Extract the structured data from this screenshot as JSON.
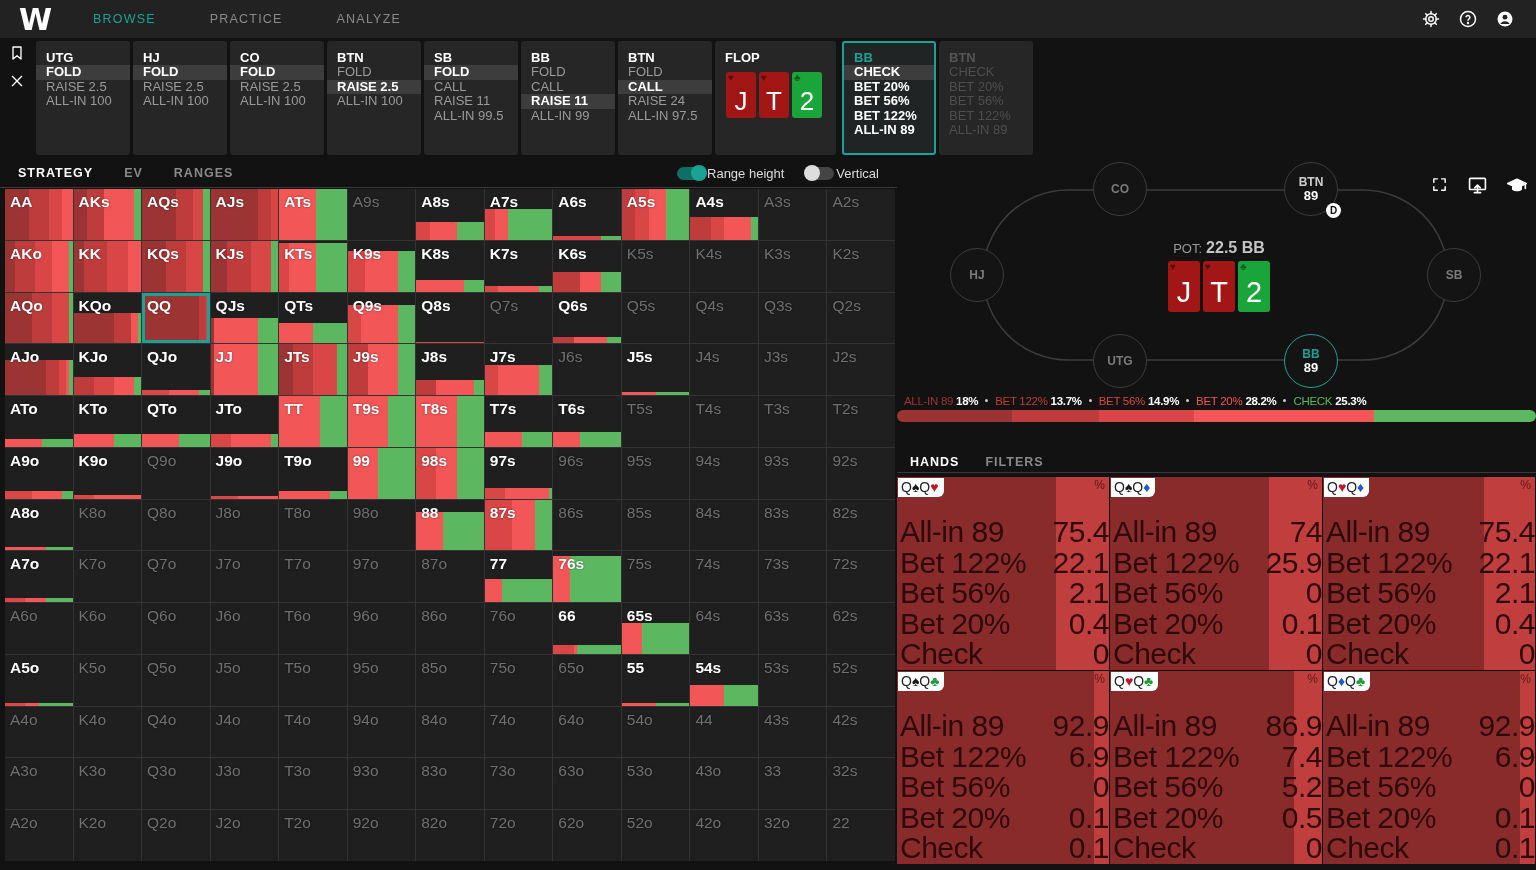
{
  "topbar": {
    "logo": "W",
    "nav": [
      {
        "label": "BROWSE",
        "selected": true
      },
      {
        "label": "PRACTICE",
        "selected": false
      },
      {
        "label": "ANALYZE",
        "selected": false
      }
    ]
  },
  "action_strip": {
    "columns": [
      {
        "kind": "action",
        "current": false,
        "disabled": false,
        "position": "UTG",
        "options": [
          {
            "label": "FOLD",
            "selected": true
          },
          {
            "label": "RAISE 2.5",
            "selected": false
          },
          {
            "label": "ALL-IN 100",
            "selected": false
          }
        ]
      },
      {
        "kind": "action",
        "current": false,
        "disabled": false,
        "position": "HJ",
        "options": [
          {
            "label": "FOLD",
            "selected": true
          },
          {
            "label": "RAISE 2.5",
            "selected": false
          },
          {
            "label": "ALL-IN 100",
            "selected": false
          }
        ]
      },
      {
        "kind": "action",
        "current": false,
        "disabled": false,
        "position": "CO",
        "options": [
          {
            "label": "FOLD",
            "selected": true
          },
          {
            "label": "RAISE 2.5",
            "selected": false
          },
          {
            "label": "ALL-IN 100",
            "selected": false
          }
        ]
      },
      {
        "kind": "action",
        "current": false,
        "disabled": false,
        "position": "BTN",
        "options": [
          {
            "label": "FOLD",
            "selected": false
          },
          {
            "label": "RAISE 2.5",
            "selected": true
          },
          {
            "label": "ALL-IN 100",
            "selected": false
          }
        ]
      },
      {
        "kind": "action",
        "current": false,
        "disabled": false,
        "position": "SB",
        "options": [
          {
            "label": "FOLD",
            "selected": true
          },
          {
            "label": "CALL",
            "selected": false
          },
          {
            "label": "RAISE 11",
            "selected": false
          },
          {
            "label": "ALL-IN 99.5",
            "selected": false
          }
        ]
      },
      {
        "kind": "action",
        "current": false,
        "disabled": false,
        "position": "BB",
        "options": [
          {
            "label": "FOLD",
            "selected": false
          },
          {
            "label": "CALL",
            "selected": false
          },
          {
            "label": "RAISE 11",
            "selected": true
          },
          {
            "label": "ALL-IN 99",
            "selected": false
          }
        ]
      },
      {
        "kind": "action",
        "current": false,
        "disabled": false,
        "position": "BTN",
        "options": [
          {
            "label": "FOLD",
            "selected": false
          },
          {
            "label": "CALL",
            "selected": true
          },
          {
            "label": "RAISE 24",
            "selected": false
          },
          {
            "label": "ALL-IN 97.5",
            "selected": false
          }
        ]
      },
      {
        "kind": "board",
        "title": "FLOP",
        "cards": [
          {
            "rank": "J",
            "suit": "♥",
            "kind": "heart"
          },
          {
            "rank": "T",
            "suit": "♥",
            "kind": "heart"
          },
          {
            "rank": "2",
            "suit": "♣",
            "kind": "club"
          }
        ]
      },
      {
        "kind": "action",
        "current": true,
        "disabled": false,
        "position": "BB",
        "options": [
          {
            "label": "CHECK",
            "selected": true
          },
          {
            "label": "BET 20%",
            "selected": false
          },
          {
            "label": "BET 56%",
            "selected": false
          },
          {
            "label": "BET 122%",
            "selected": false
          },
          {
            "label": "ALL-IN 89",
            "selected": false
          }
        ]
      },
      {
        "kind": "action",
        "current": false,
        "disabled": true,
        "position": "BTN",
        "options": [
          {
            "label": "CHECK",
            "selected": false
          },
          {
            "label": "BET 20%",
            "selected": false
          },
          {
            "label": "BET 56%",
            "selected": false
          },
          {
            "label": "BET 122%",
            "selected": false
          },
          {
            "label": "ALL-IN 89",
            "selected": false
          }
        ]
      }
    ]
  },
  "strategy": {
    "tabs": [
      {
        "label": "STRATEGY",
        "selected": true
      },
      {
        "label": "EV",
        "selected": false
      },
      {
        "label": "RANGES",
        "selected": false
      }
    ],
    "toggles": [
      {
        "label": "Range height",
        "on": true
      },
      {
        "label": "Vertical",
        "on": false
      }
    ],
    "grid": [
      {
        "cells": [
          {
            "label": "AA",
            "active": true,
            "selected": false
          },
          {
            "label": "AKs",
            "active": true,
            "selected": false
          },
          {
            "label": "AQs",
            "active": true,
            "selected": false
          },
          {
            "label": "AJs",
            "active": true,
            "selected": false
          },
          {
            "label": "ATs",
            "active": true,
            "selected": false
          },
          {
            "label": "A9s",
            "active": false,
            "selected": false
          },
          {
            "label": "A8s",
            "active": true,
            "selected": false
          },
          {
            "label": "A7s",
            "active": true,
            "selected": false
          },
          {
            "label": "A6s",
            "active": true,
            "selected": false
          },
          {
            "label": "A5s",
            "active": true,
            "selected": false
          },
          {
            "label": "A4s",
            "active": true,
            "selected": false
          },
          {
            "label": "A3s",
            "active": false,
            "selected": false
          },
          {
            "label": "A2s",
            "active": false,
            "selected": false
          }
        ]
      },
      {
        "cells": [
          {
            "label": "AKo",
            "active": true,
            "selected": false
          },
          {
            "label": "KK",
            "active": true,
            "selected": false
          },
          {
            "label": "KQs",
            "active": true,
            "selected": false
          },
          {
            "label": "KJs",
            "active": true,
            "selected": false
          },
          {
            "label": "KTs",
            "active": true,
            "selected": false
          },
          {
            "label": "K9s",
            "active": true,
            "selected": false
          },
          {
            "label": "K8s",
            "active": true,
            "selected": false
          },
          {
            "label": "K7s",
            "active": true,
            "selected": false
          },
          {
            "label": "K6s",
            "active": true,
            "selected": false
          },
          {
            "label": "K5s",
            "active": false,
            "selected": false
          },
          {
            "label": "K4s",
            "active": false,
            "selected": false
          },
          {
            "label": "K3s",
            "active": false,
            "selected": false
          },
          {
            "label": "K2s",
            "active": false,
            "selected": false
          }
        ]
      },
      {
        "cells": [
          {
            "label": "AQo",
            "active": true,
            "selected": false
          },
          {
            "label": "KQo",
            "active": true,
            "selected": false
          },
          {
            "label": "QQ",
            "active": true,
            "selected": true
          },
          {
            "label": "QJs",
            "active": true,
            "selected": false
          },
          {
            "label": "QTs",
            "active": true,
            "selected": false
          },
          {
            "label": "Q9s",
            "active": true,
            "selected": false
          },
          {
            "label": "Q8s",
            "active": true,
            "selected": false
          },
          {
            "label": "Q7s",
            "active": false,
            "selected": false
          },
          {
            "label": "Q6s",
            "active": true,
            "selected": false
          },
          {
            "label": "Q5s",
            "active": false,
            "selected": false
          },
          {
            "label": "Q4s",
            "active": false,
            "selected": false
          },
          {
            "label": "Q3s",
            "active": false,
            "selected": false
          },
          {
            "label": "Q2s",
            "active": false,
            "selected": false
          }
        ]
      },
      {
        "cells": [
          {
            "label": "AJo",
            "active": true,
            "selected": false
          },
          {
            "label": "KJo",
            "active": true,
            "selected": false
          },
          {
            "label": "QJo",
            "active": true,
            "selected": false
          },
          {
            "label": "JJ",
            "active": true,
            "selected": false
          },
          {
            "label": "JTs",
            "active": true,
            "selected": false
          },
          {
            "label": "J9s",
            "active": true,
            "selected": false
          },
          {
            "label": "J8s",
            "active": true,
            "selected": false
          },
          {
            "label": "J7s",
            "active": true,
            "selected": false
          },
          {
            "label": "J6s",
            "active": false,
            "selected": false
          },
          {
            "label": "J5s",
            "active": true,
            "selected": false
          },
          {
            "label": "J4s",
            "active": false,
            "selected": false
          },
          {
            "label": "J3s",
            "active": false,
            "selected": false
          },
          {
            "label": "J2s",
            "active": false,
            "selected": false
          }
        ]
      },
      {
        "cells": [
          {
            "label": "ATo",
            "active": true,
            "selected": false
          },
          {
            "label": "KTo",
            "active": true,
            "selected": false
          },
          {
            "label": "QTo",
            "active": true,
            "selected": false
          },
          {
            "label": "JTo",
            "active": true,
            "selected": false
          },
          {
            "label": "TT",
            "active": true,
            "selected": false
          },
          {
            "label": "T9s",
            "active": true,
            "selected": false
          },
          {
            "label": "T8s",
            "active": true,
            "selected": false
          },
          {
            "label": "T7s",
            "active": true,
            "selected": false
          },
          {
            "label": "T6s",
            "active": true,
            "selected": false
          },
          {
            "label": "T5s",
            "active": false,
            "selected": false
          },
          {
            "label": "T4s",
            "active": false,
            "selected": false
          },
          {
            "label": "T3s",
            "active": false,
            "selected": false
          },
          {
            "label": "T2s",
            "active": false,
            "selected": false
          }
        ]
      },
      {
        "cells": [
          {
            "label": "A9o",
            "active": true,
            "selected": false
          },
          {
            "label": "K9o",
            "active": true,
            "selected": false
          },
          {
            "label": "Q9o",
            "active": false,
            "selected": false
          },
          {
            "label": "J9o",
            "active": true,
            "selected": false
          },
          {
            "label": "T9o",
            "active": true,
            "selected": false
          },
          {
            "label": "99",
            "active": true,
            "selected": false
          },
          {
            "label": "98s",
            "active": true,
            "selected": false
          },
          {
            "label": "97s",
            "active": true,
            "selected": false
          },
          {
            "label": "96s",
            "active": false,
            "selected": false
          },
          {
            "label": "95s",
            "active": false,
            "selected": false
          },
          {
            "label": "94s",
            "active": false,
            "selected": false
          },
          {
            "label": "93s",
            "active": false,
            "selected": false
          },
          {
            "label": "92s",
            "active": false,
            "selected": false
          }
        ]
      },
      {
        "cells": [
          {
            "label": "A8o",
            "active": true,
            "selected": false
          },
          {
            "label": "K8o",
            "active": false,
            "selected": false
          },
          {
            "label": "Q8o",
            "active": false,
            "selected": false
          },
          {
            "label": "J8o",
            "active": false,
            "selected": false
          },
          {
            "label": "T8o",
            "active": false,
            "selected": false
          },
          {
            "label": "98o",
            "active": false,
            "selected": false
          },
          {
            "label": "88",
            "active": true,
            "selected": false
          },
          {
            "label": "87s",
            "active": true,
            "selected": false
          },
          {
            "label": "86s",
            "active": false,
            "selected": false
          },
          {
            "label": "85s",
            "active": false,
            "selected": false
          },
          {
            "label": "84s",
            "active": false,
            "selected": false
          },
          {
            "label": "83s",
            "active": false,
            "selected": false
          },
          {
            "label": "82s",
            "active": false,
            "selected": false
          }
        ]
      },
      {
        "cells": [
          {
            "label": "A7o",
            "active": true,
            "selected": false
          },
          {
            "label": "K7o",
            "active": false,
            "selected": false
          },
          {
            "label": "Q7o",
            "active": false,
            "selected": false
          },
          {
            "label": "J7o",
            "active": false,
            "selected": false
          },
          {
            "label": "T7o",
            "active": false,
            "selected": false
          },
          {
            "label": "97o",
            "active": false,
            "selected": false
          },
          {
            "label": "87o",
            "active": false,
            "selected": false
          },
          {
            "label": "77",
            "active": true,
            "selected": false
          },
          {
            "label": "76s",
            "active": true,
            "selected": false
          },
          {
            "label": "75s",
            "active": false,
            "selected": false
          },
          {
            "label": "74s",
            "active": false,
            "selected": false
          },
          {
            "label": "73s",
            "active": false,
            "selected": false
          },
          {
            "label": "72s",
            "active": false,
            "selected": false
          }
        ]
      },
      {
        "cells": [
          {
            "label": "A6o",
            "active": false,
            "selected": false
          },
          {
            "label": "K6o",
            "active": false,
            "selected": false
          },
          {
            "label": "Q6o",
            "active": false,
            "selected": false
          },
          {
            "label": "J6o",
            "active": false,
            "selected": false
          },
          {
            "label": "T6o",
            "active": false,
            "selected": false
          },
          {
            "label": "96o",
            "active": false,
            "selected": false
          },
          {
            "label": "86o",
            "active": false,
            "selected": false
          },
          {
            "label": "76o",
            "active": false,
            "selected": false
          },
          {
            "label": "66",
            "active": true,
            "selected": false
          },
          {
            "label": "65s",
            "active": true,
            "selected": false
          },
          {
            "label": "64s",
            "active": false,
            "selected": false
          },
          {
            "label": "63s",
            "active": false,
            "selected": false
          },
          {
            "label": "62s",
            "active": false,
            "selected": false
          }
        ]
      },
      {
        "cells": [
          {
            "label": "A5o",
            "active": true,
            "selected": false
          },
          {
            "label": "K5o",
            "active": false,
            "selected": false
          },
          {
            "label": "Q5o",
            "active": false,
            "selected": false
          },
          {
            "label": "J5o",
            "active": false,
            "selected": false
          },
          {
            "label": "T5o",
            "active": false,
            "selected": false
          },
          {
            "label": "95o",
            "active": false,
            "selected": false
          },
          {
            "label": "85o",
            "active": false,
            "selected": false
          },
          {
            "label": "75o",
            "active": false,
            "selected": false
          },
          {
            "label": "65o",
            "active": false,
            "selected": false
          },
          {
            "label": "55",
            "active": true,
            "selected": false
          },
          {
            "label": "54s",
            "active": true,
            "selected": false
          },
          {
            "label": "53s",
            "active": false,
            "selected": false
          },
          {
            "label": "52s",
            "active": false,
            "selected": false
          }
        ]
      },
      {
        "cells": [
          {
            "label": "A4o",
            "active": false,
            "selected": false
          },
          {
            "label": "K4o",
            "active": false,
            "selected": false
          },
          {
            "label": "Q4o",
            "active": false,
            "selected": false
          },
          {
            "label": "J4o",
            "active": false,
            "selected": false
          },
          {
            "label": "T4o",
            "active": false,
            "selected": false
          },
          {
            "label": "94o",
            "active": false,
            "selected": false
          },
          {
            "label": "84o",
            "active": false,
            "selected": false
          },
          {
            "label": "74o",
            "active": false,
            "selected": false
          },
          {
            "label": "64o",
            "active": false,
            "selected": false
          },
          {
            "label": "54o",
            "active": false,
            "selected": false
          },
          {
            "label": "44",
            "active": false,
            "selected": false
          },
          {
            "label": "43s",
            "active": false,
            "selected": false
          },
          {
            "label": "42s",
            "active": false,
            "selected": false
          }
        ]
      },
      {
        "cells": [
          {
            "label": "A3o",
            "active": false,
            "selected": false
          },
          {
            "label": "K3o",
            "active": false,
            "selected": false
          },
          {
            "label": "Q3o",
            "active": false,
            "selected": false
          },
          {
            "label": "J3o",
            "active": false,
            "selected": false
          },
          {
            "label": "T3o",
            "active": false,
            "selected": false
          },
          {
            "label": "93o",
            "active": false,
            "selected": false
          },
          {
            "label": "83o",
            "active": false,
            "selected": false
          },
          {
            "label": "73o",
            "active": false,
            "selected": false
          },
          {
            "label": "63o",
            "active": false,
            "selected": false
          },
          {
            "label": "53o",
            "active": false,
            "selected": false
          },
          {
            "label": "43o",
            "active": false,
            "selected": false
          },
          {
            "label": "33",
            "active": false,
            "selected": false
          },
          {
            "label": "32s",
            "active": false,
            "selected": false
          }
        ]
      },
      {
        "cells": [
          {
            "label": "A2o",
            "active": false,
            "selected": false
          },
          {
            "label": "K2o",
            "active": false,
            "selected": false
          },
          {
            "label": "Q2o",
            "active": false,
            "selected": false
          },
          {
            "label": "J2o",
            "active": false,
            "selected": false
          },
          {
            "label": "T2o",
            "active": false,
            "selected": false
          },
          {
            "label": "92o",
            "active": false,
            "selected": false
          },
          {
            "label": "82o",
            "active": false,
            "selected": false
          },
          {
            "label": "72o",
            "active": false,
            "selected": false
          },
          {
            "label": "62o",
            "active": false,
            "selected": false
          },
          {
            "label": "52o",
            "active": false,
            "selected": false
          },
          {
            "label": "42o",
            "active": false,
            "selected": false
          },
          {
            "label": "32o",
            "active": false,
            "selected": false
          },
          {
            "label": "22",
            "active": false,
            "selected": false
          }
        ]
      }
    ]
  },
  "table": {
    "seats": [
      {
        "position": "CO",
        "active": false
      },
      {
        "position": "BTN",
        "stack": "89",
        "dealer": "D",
        "active": false
      },
      {
        "position": "HJ",
        "active": false
      },
      {
        "position": "SB",
        "active": false
      },
      {
        "position": "UTG",
        "active": false
      },
      {
        "position": "BB",
        "stack": "89",
        "active": true
      }
    ],
    "pot": {
      "label": "POT:",
      "value": "22.5 BB"
    },
    "board": [
      {
        "rank": "J",
        "suit": "♥",
        "kind": "heart"
      },
      {
        "rank": "T",
        "suit": "♥",
        "kind": "heart"
      },
      {
        "rank": "2",
        "suit": "♣",
        "kind": "club"
      }
    ]
  },
  "strategy_summary": {
    "actions": [
      {
        "kind": "allin",
        "label": "ALL-IN 89",
        "value": "18%",
        "color": "#9c3434"
      },
      {
        "kind": "bet122",
        "label": "BET 122%",
        "value": "13.7%",
        "color": "#bf3c3c"
      },
      {
        "kind": "bet56",
        "label": "BET 56%",
        "value": "14.9%",
        "color": "#d84646"
      },
      {
        "kind": "bet20",
        "label": "BET 20%",
        "value": "28.2%",
        "color": "#f25656"
      },
      {
        "kind": "check",
        "label": "CHECK",
        "value": "25.3%",
        "color": "#5cb860"
      }
    ]
  },
  "hands": {
    "tabs": [
      {
        "label": "HANDS",
        "selected": true
      },
      {
        "label": "FILTERS",
        "selected": false
      }
    ],
    "combos": [
      {
        "cards": [
          {
            "rank": "Q",
            "suit": "♠",
            "kind": "spade"
          },
          {
            "rank": "Q",
            "suit": "♥",
            "kind": "heart"
          }
        ],
        "unit": "%",
        "level": 0.25,
        "rows": [
          {
            "label": "All-in 89",
            "value": "75.4"
          },
          {
            "label": "Bet 122%",
            "value": "22.1"
          },
          {
            "label": "Bet 56%",
            "value": "2.1"
          },
          {
            "label": "Bet 20%",
            "value": "0.4"
          },
          {
            "label": "Check",
            "value": "0"
          }
        ]
      },
      {
        "cards": [
          {
            "rank": "Q",
            "suit": "♠",
            "kind": "spade"
          },
          {
            "rank": "Q",
            "suit": "♦",
            "kind": "diamond"
          }
        ],
        "unit": "%",
        "level": 0.25,
        "rows": [
          {
            "label": "All-in 89",
            "value": "74"
          },
          {
            "label": "Bet 122%",
            "value": "25.9"
          },
          {
            "label": "Bet 56%",
            "value": "0"
          },
          {
            "label": "Bet 20%",
            "value": "0.1"
          },
          {
            "label": "Check",
            "value": "0"
          }
        ]
      },
      {
        "cards": [
          {
            "rank": "Q",
            "suit": "♥",
            "kind": "heart"
          },
          {
            "rank": "Q",
            "suit": "♦",
            "kind": "diamond"
          }
        ],
        "unit": "%",
        "level": 0.24,
        "rows": [
          {
            "label": "All-in 89",
            "value": "75.4"
          },
          {
            "label": "Bet 122%",
            "value": "22.1"
          },
          {
            "label": "Bet 56%",
            "value": "2.1"
          },
          {
            "label": "Bet 20%",
            "value": "0.4"
          },
          {
            "label": "Check",
            "value": "0"
          }
        ]
      },
      {
        "cards": [
          {
            "rank": "Q",
            "suit": "♠",
            "kind": "spade"
          },
          {
            "rank": "Q",
            "suit": "♣",
            "kind": "club"
          }
        ],
        "unit": "%",
        "level": 0.07,
        "rows": [
          {
            "label": "All-in 89",
            "value": "92.9"
          },
          {
            "label": "Bet 122%",
            "value": "6.9"
          },
          {
            "label": "Bet 56%",
            "value": "0"
          },
          {
            "label": "Bet 20%",
            "value": "0.1"
          },
          {
            "label": "Check",
            "value": "0.1"
          }
        ]
      },
      {
        "cards": [
          {
            "rank": "Q",
            "suit": "♥",
            "kind": "heart"
          },
          {
            "rank": "Q",
            "suit": "♣",
            "kind": "club"
          }
        ],
        "unit": "%",
        "level": 0.13,
        "rows": [
          {
            "label": "All-in 89",
            "value": "86.9"
          },
          {
            "label": "Bet 122%",
            "value": "7.4"
          },
          {
            "label": "Bet 56%",
            "value": "5.2"
          },
          {
            "label": "Bet 20%",
            "value": "0.5"
          },
          {
            "label": "Check",
            "value": "0"
          }
        ]
      },
      {
        "cards": [
          {
            "rank": "Q",
            "suit": "♦",
            "kind": "diamond"
          },
          {
            "rank": "Q",
            "suit": "♣",
            "kind": "club"
          }
        ],
        "unit": "%",
        "level": 0.07,
        "rows": [
          {
            "label": "All-in 89",
            "value": "92.9"
          },
          {
            "label": "Bet 122%",
            "value": "6.9"
          },
          {
            "label": "Bet 56%",
            "value": "0"
          },
          {
            "label": "Bet 20%",
            "value": "0.1"
          },
          {
            "label": "Check",
            "value": "0.1"
          }
        ]
      }
    ]
  }
}
